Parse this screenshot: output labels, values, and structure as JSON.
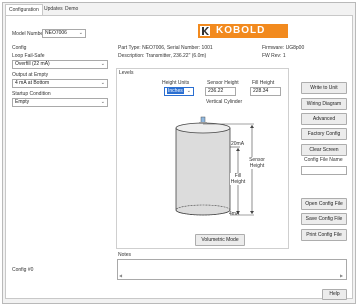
{
  "tabs": [
    {
      "label": "Configuration"
    },
    {
      "label": "Updates"
    },
    {
      "label": "Demo"
    }
  ],
  "model": {
    "label": "Model Number",
    "value": "NEO7006"
  },
  "config": {
    "label": "Config",
    "loop_fail_safe": {
      "label": "Loop Fail-Safe",
      "value": "Overfill (22 mA)"
    },
    "output_at_empty": {
      "label": "Output at Empty",
      "value": "4 mA at Bottom"
    },
    "startup_condition": {
      "label": "Startup Condition",
      "value": "Empty"
    }
  },
  "brand": {
    "logo_text": "KOBOLD"
  },
  "info": {
    "part_type": "Part Type: NEO7006, Serial Number: 1001",
    "description": "Description: Transmitter, 236.22\" (6.0m)",
    "firmware": "Firmware: UG8p00",
    "fw_rev": "FW Rev: 1"
  },
  "levels": {
    "label": "Levels",
    "height_units": {
      "label": "Height Units",
      "value": "Inches"
    },
    "sensor_height": {
      "label": "Sensor Height",
      "value": "236.22"
    },
    "fill_height": {
      "label": "Fill Height",
      "value": "228.34"
    },
    "vessel_type": "Vertical Cylinder",
    "diagram": {
      "top_ma": "20mA",
      "bottom_ma": "4mA",
      "fill_height_label": "Fill Height",
      "sensor_height_label": "Sensor Height"
    },
    "volumetric_mode_button": "Volumetric Mode"
  },
  "right_buttons": {
    "write_to_unit": "Write to Unit",
    "wiring_diagram": "Wiring Diagram",
    "advanced": "Advanced",
    "factory_config": "Factory Config",
    "clear_screen": "Clear Screen",
    "config_file_name_label": "Config File Name",
    "config_file_name_value": "",
    "open_config_file": "Open Config File",
    "save_config_file": "Save Config File",
    "print_config_file": "Print Config File"
  },
  "notes": {
    "label": "Notes",
    "value": ""
  },
  "footer": {
    "config_number": "Config #0",
    "help": "Help"
  },
  "colors": {
    "accent_blue": "#2b6fd1",
    "logo_orange": "#f28a1e",
    "tank_fill": "#dcdcdc"
  }
}
